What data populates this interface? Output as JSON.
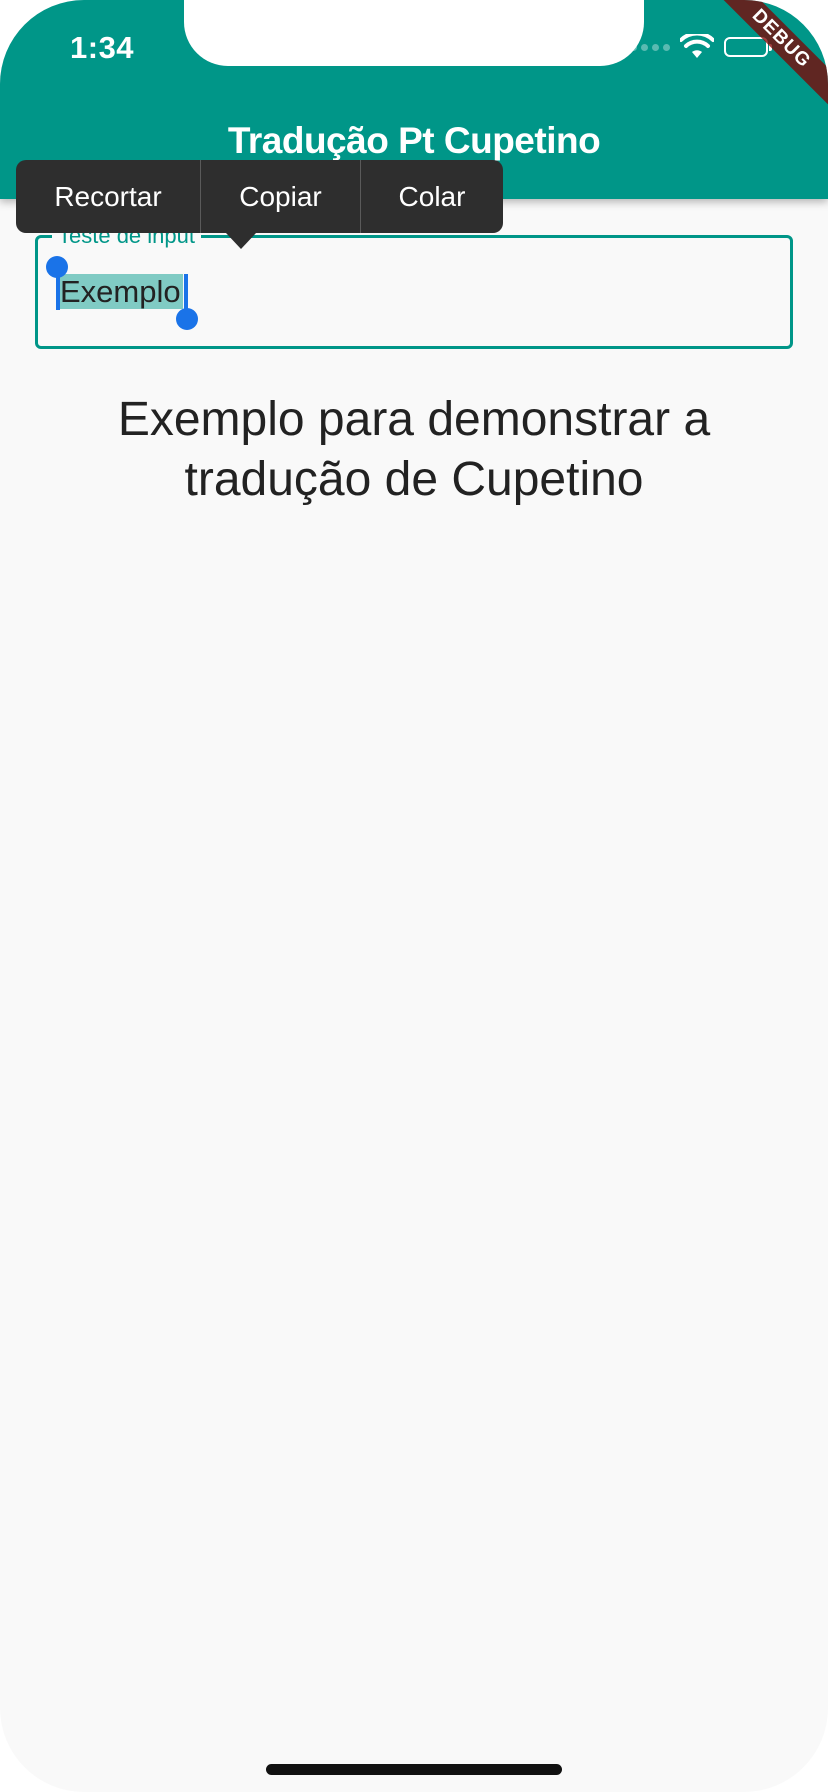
{
  "status_bar": {
    "time": "1:34",
    "debug_banner": "DEBUG"
  },
  "app_bar": {
    "title": "Tradução Pt Cupetino",
    "color": "#009688"
  },
  "text_selection_toolbar": {
    "cut_label": "Recortar",
    "copy_label": "Copiar",
    "paste_label": "Colar"
  },
  "input": {
    "label": "Teste de input",
    "value": "Exemplo",
    "selection_color": "#80cbc4"
  },
  "body": {
    "line1": "Exemplo para demonstrar a",
    "line2": "tradução de Cupetino"
  }
}
